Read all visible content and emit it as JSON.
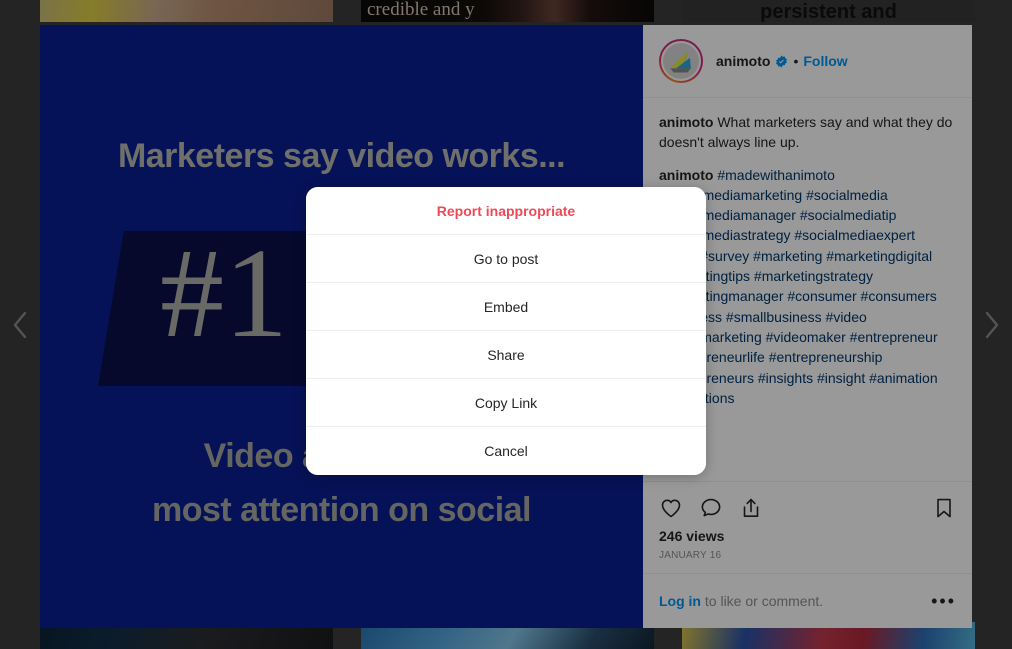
{
  "background": {
    "tiles_top": [
      {
        "name": "tile-top-1",
        "text": ""
      },
      {
        "name": "tile-top-2",
        "text": "credible and y"
      },
      {
        "name": "tile-top-3",
        "text": "persistent and"
      }
    ],
    "tiles_bottom": [
      {
        "name": "tile-bottom-1",
        "text": ""
      },
      {
        "name": "tile-bottom-2",
        "text": ""
      },
      {
        "name": "tile-bottom-3",
        "text": ""
      }
    ]
  },
  "nav": {
    "prev_label": "Previous",
    "next_label": "Next"
  },
  "post": {
    "media": {
      "headline": "Marketers say video works...",
      "number": "#1",
      "sub_line_1": "Video attracts the",
      "sub_line_2": "most attention on social",
      "bg_color": "#0a1f91",
      "plate_color": "#0a0f48",
      "text_color": "#b9b9b2"
    },
    "header": {
      "username": "animoto",
      "verified": true,
      "separator": "•",
      "follow_label": "Follow"
    },
    "caption": {
      "author": "animoto",
      "text": "What marketers say and what they do doesn't always line up."
    },
    "hashtag_comment": {
      "author": "animoto",
      "hashtags": "#madewithanimoto #socialmediamarketing #socialmedia #socialmediamanager #socialmediatip #socialmediastrategy #socialmediaexpert #stats #survey #marketing #marketingdigital #marketingtips #marketingstrategy #marketingmanager #consumer #consumers #business #smallbusiness #video #videomarketing #videomaker #entrepreneur #entrepreneurlife #entrepreneurship #entrepreneurs #insights #insight #animation #animations"
    },
    "actions": {
      "like_icon": "heart-icon",
      "comment_icon": "comment-icon",
      "share_icon": "share-icon",
      "save_icon": "bookmark-icon",
      "views": "246 views",
      "date": "JANUARY 16"
    },
    "footer": {
      "login_link": "Log in",
      "login_text": " to like or comment.",
      "more_label": "•••"
    }
  },
  "action_sheet": {
    "items": [
      {
        "label": "Report inappropriate",
        "style": "danger",
        "name": "report-inappropriate"
      },
      {
        "label": "Go to post",
        "style": "normal",
        "name": "go-to-post"
      },
      {
        "label": "Embed",
        "style": "normal",
        "name": "embed"
      },
      {
        "label": "Share",
        "style": "normal",
        "name": "share"
      },
      {
        "label": "Copy Link",
        "style": "normal",
        "name": "copy-link"
      },
      {
        "label": "Cancel",
        "style": "normal",
        "name": "cancel"
      }
    ]
  },
  "colors": {
    "instagram_blue": "#0095f6",
    "danger_red": "#ed4956",
    "link_dark_blue": "#00376b",
    "text_primary": "#262626",
    "text_muted": "#8e8e8e"
  }
}
